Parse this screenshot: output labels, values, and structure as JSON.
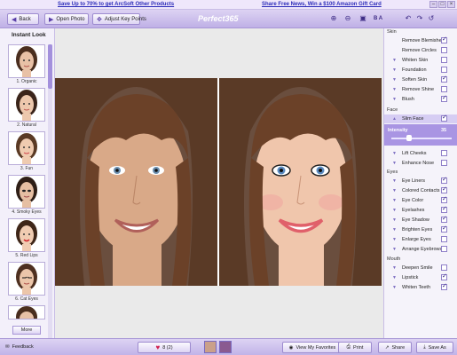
{
  "promo": {
    "left": "Save Up to 70% to get ArcSoft Other Products",
    "right": "Share Free News, Win a $100 Amazon Gift Card"
  },
  "toolbar": {
    "back": "Back",
    "open_photo": "Open Photo",
    "adjust_key_points": "Adjust Key Points",
    "brand": "Perfect365",
    "ba_label": "B A"
  },
  "left_panel": {
    "title": "Instant Look",
    "looks": [
      "1. Organic",
      "2. Natural",
      "3. Fun",
      "4. Smoky Eyes",
      "5. Red Lips",
      "6. Cat Eyes"
    ],
    "more": "More"
  },
  "right_panel": {
    "skin_title": "Skin",
    "skin": [
      {
        "label": "Remove Blemishes",
        "checked": true
      },
      {
        "label": "Remove Circles",
        "checked": false
      },
      {
        "label": "Whiten Skin",
        "checked": false
      },
      {
        "label": "Foundation",
        "checked": false
      },
      {
        "label": "Soften Skin",
        "checked": true
      },
      {
        "label": "Remove Shine",
        "checked": false
      },
      {
        "label": "Blush",
        "checked": true
      }
    ],
    "face_title": "Face",
    "slim_face": "Slim Face",
    "intensity_label": "Intensity",
    "intensity_value": "35",
    "face": [
      {
        "label": "Lift Cheeks",
        "checked": false
      },
      {
        "label": "Enhance Nose",
        "checked": false
      }
    ],
    "eyes_title": "Eyes",
    "eyes": [
      {
        "label": "Eye Liners",
        "checked": true
      },
      {
        "label": "Colored Contacts",
        "checked": true
      },
      {
        "label": "Eye Color",
        "checked": true
      },
      {
        "label": "Eyelashes",
        "checked": true
      },
      {
        "label": "Eye Shadow",
        "checked": true
      },
      {
        "label": "Brighten Eyes",
        "checked": true
      },
      {
        "label": "Enlarge Eyes",
        "checked": false
      },
      {
        "label": "Arrange Eyebrows",
        "checked": false
      }
    ],
    "mouth_title": "Mouth",
    "mouth": [
      {
        "label": "Deepen Smile",
        "checked": false
      },
      {
        "label": "Lipstick",
        "checked": true
      },
      {
        "label": "Whiten Teeth",
        "checked": true
      }
    ]
  },
  "bottom": {
    "feedback": "Feedback",
    "likes": "8 (2)",
    "favorites": "View My Favorites",
    "print": "Print",
    "share": "Share",
    "save_as": "Save As"
  }
}
